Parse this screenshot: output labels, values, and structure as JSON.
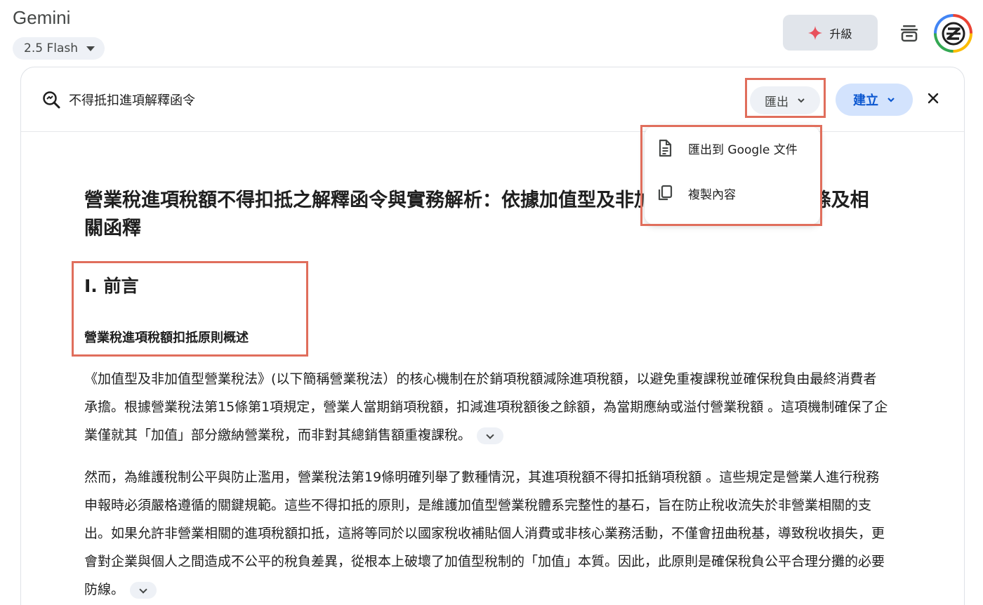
{
  "app": {
    "title": "Gemini",
    "model": "2.5 Flash",
    "upgrade_label": "升級"
  },
  "canvas": {
    "doc_title": "不得抵扣進項解釋函令",
    "export_label": "匯出",
    "create_label": "建立"
  },
  "export_menu": {
    "items": [
      {
        "label": "匯出到 Google 文件"
      },
      {
        "label": "複製內容"
      }
    ]
  },
  "document": {
    "title": "營業稅進項稅額不得扣抵之解釋函令與實務解析：依據加值型及非加值型營業稅法第19條及相關函釋",
    "section_heading": "I. 前言",
    "subheading": "營業稅進項稅額扣抵原則概述",
    "paragraphs": [
      "《加值型及非加值型營業稅法》(以下簡稱營業稅法）的核心機制在於銷項稅額減除進項稅額，以避免重複課稅並確保稅負由最終消費者承擔。根據營業稅法第15條第1項規定，營業人當期銷項稅額，扣減進項稅額後之餘額，為當期應納或溢付營業稅額 。這項機制確保了企業僅就其「加值」部分繳納營業稅，而非對其總銷售額重複課稅。",
      "然而，為維護稅制公平與防止濫用，營業稅法第19條明確列舉了數種情況，其進項稅額不得扣抵銷項稅額 。這些規定是營業人進行稅務申報時必須嚴格遵循的關鍵規範。這些不得扣抵的原則，是維護加值型營業稅體系完整性的基石，旨在防止稅收流失於非營業相關的支出。如果允許非營業相關的進項稅額扣抵，這將等同於以國家稅收補貼個人消費或非核心業務活動，不僅會扭曲稅基，導致稅收損失，更會對企業與個人之間造成不公平的稅負差異，從根本上破壞了加值型稅制的「加值」本質。因此，此原則是確保稅負公平合理分攤的必要防線。"
    ]
  },
  "colors": {
    "highlight": "#e06e5c",
    "accent": "#0b57d0",
    "create_bg": "#d3e3fd"
  }
}
